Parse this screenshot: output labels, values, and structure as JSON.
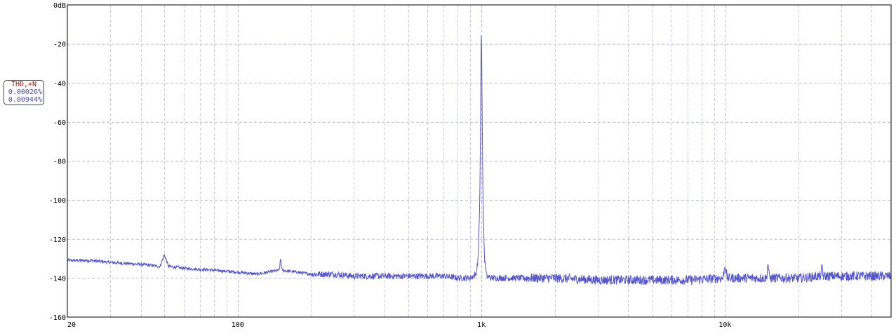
{
  "chart_data": {
    "type": "line",
    "title": "",
    "xlabel": "",
    "ylabel": "",
    "x_scale": "log",
    "xlim": [
      20,
      48000
    ],
    "ylim": [
      -160,
      0
    ],
    "grid": true,
    "y_ticks": [
      {
        "value": 0,
        "label": "0dB"
      },
      {
        "value": -20,
        "label": "-20"
      },
      {
        "value": -40,
        "label": "-40"
      },
      {
        "value": -60,
        "label": "-60"
      },
      {
        "value": -80,
        "label": "-80"
      },
      {
        "value": -100,
        "label": "-100"
      },
      {
        "value": -120,
        "label": "-120"
      },
      {
        "value": -140,
        "label": "-140"
      },
      {
        "value": -160,
        "label": "-160"
      }
    ],
    "x_ticks": [
      {
        "value": 20,
        "label": "20"
      },
      {
        "value": 100,
        "label": "100"
      },
      {
        "value": 1000,
        "label": "1k"
      },
      {
        "value": 10000,
        "label": "10k"
      }
    ],
    "series": [
      {
        "color": "#5555cc",
        "x": [
          20,
          25,
          30,
          40,
          48,
          50,
          52,
          60,
          80,
          100,
          120,
          148,
          150,
          152,
          200,
          250,
          300,
          400,
          500,
          600,
          700,
          800,
          900,
          950,
          970,
          985,
          995,
          1000,
          1005,
          1015,
          1030,
          1050,
          1100,
          1300,
          1600,
          2000,
          3000,
          5000,
          7000,
          9800,
          10000,
          10200,
          12000,
          14800,
          15000,
          15200,
          20000,
          24800,
          25000,
          25200,
          30000,
          40000,
          48000
        ],
        "y": [
          -131,
          -131,
          -132,
          -133,
          -134,
          -128,
          -134,
          -135,
          -136,
          -137,
          -138,
          -136,
          -130,
          -136,
          -138,
          -138,
          -139,
          -139,
          -139,
          -139,
          -139,
          -140,
          -140,
          -138,
          -130,
          -100,
          -40,
          -10,
          -40,
          -100,
          -130,
          -139,
          -140,
          -140,
          -140,
          -140,
          -141,
          -141,
          -141,
          -140,
          -133,
          -140,
          -140,
          -140,
          -132,
          -140,
          -140,
          -139,
          -133,
          -139,
          -139,
          -139,
          -139
        ]
      }
    ],
    "annotations": [
      {
        "text": "THD,+N"
      },
      {
        "text": "0.00026%"
      },
      {
        "text": "0.00944%"
      }
    ]
  },
  "legend": {
    "title": "THD,+N",
    "thd": "0.00026%",
    "thdn": "0.00944%"
  }
}
